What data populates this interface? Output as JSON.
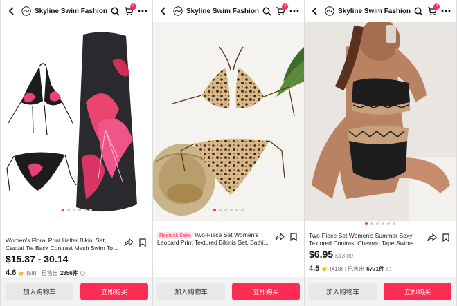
{
  "store": {
    "name": "Skyline Swim Fashion",
    "cart_count": "4"
  },
  "colors": {
    "accent": "#fe2c55",
    "restock_bg": "#ffe1e8"
  },
  "products": [
    {
      "title": "Women's Floral Print Halter Bikini Set, Casual Tie Back Contrast Mesh Swim To...",
      "restock": "",
      "price": "$15.37 - 30.14",
      "old_price": "",
      "rating": "4.6",
      "reviews": "(58)",
      "sold_label": "| 已售出",
      "sold": "2856件",
      "carousel_total": 6,
      "carousel_index": 0
    },
    {
      "title": "Two-Piece Set Women's Leopard Print Textured Bikinis Set, Bathi...",
      "restock": "Restock Sale",
      "price": "",
      "old_price": "",
      "rating": "",
      "reviews": "",
      "sold_label": "",
      "sold": "",
      "carousel_total": 6,
      "carousel_index": 0
    },
    {
      "title": "Two-Piece Set Women's Summer Sexy Textured Contrast Chevron Tape Swims...",
      "restock": "",
      "price": "$6.95",
      "old_price": "$13.89",
      "rating": "4.5",
      "reviews": "(418)",
      "sold_label": "| 已售出",
      "sold": "6771件",
      "carousel_total": 6,
      "carousel_index": 0
    }
  ],
  "actions": {
    "add_to_cart": "加入购物车",
    "buy_now": "立即购买"
  },
  "icons": [
    "back-icon",
    "store-logo-icon",
    "search-icon",
    "cart-icon",
    "more-icon",
    "share-icon",
    "bookmark-icon",
    "star-icon",
    "info-icon"
  ]
}
